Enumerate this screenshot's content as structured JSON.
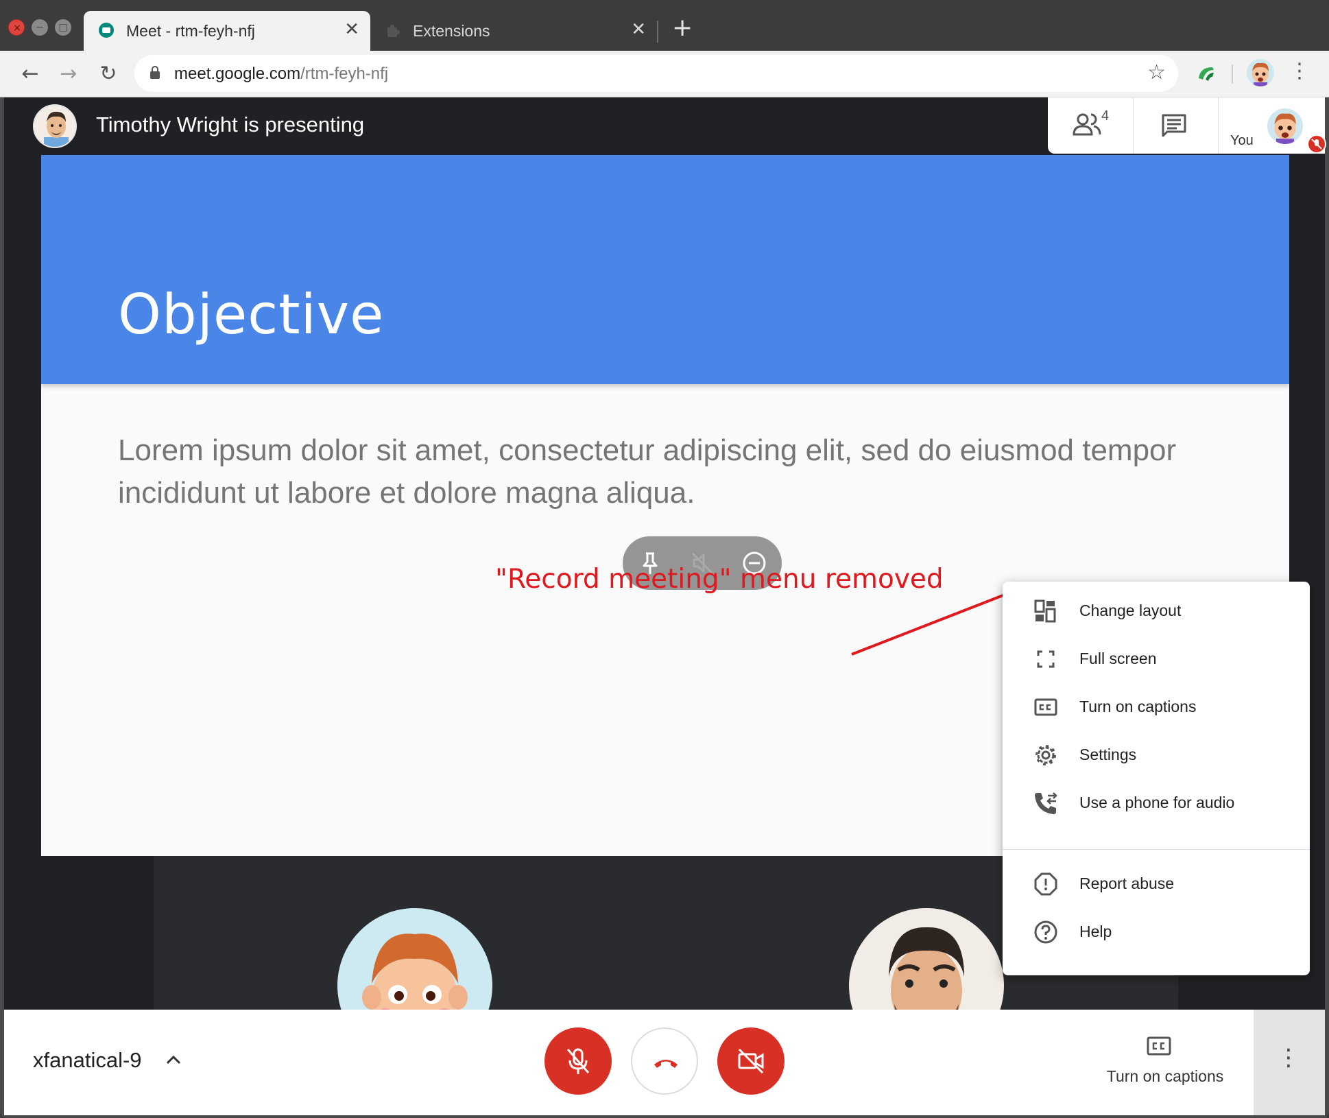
{
  "browser": {
    "tabs": [
      {
        "title": "Meet - rtm-feyh-nfj",
        "close": "✕"
      },
      {
        "title": "Extensions",
        "close": "✕"
      }
    ],
    "new_tab_glyph": "+",
    "url_host": "meet.google.com",
    "url_path": "/rtm-feyh-nfj",
    "nav": {
      "back": "←",
      "forward": "→",
      "reload": "↻"
    },
    "star": "☆",
    "menu_glyph": "⋮",
    "window_buttons": {
      "close": "×",
      "minimize": "−",
      "zoom": "□"
    }
  },
  "meet": {
    "presenting_text": "Timothy Wright is presenting",
    "participants_count": "4",
    "you_label": "You",
    "slide": {
      "title": "Objective",
      "body": "Lorem ipsum dolor sit amet, consectetur adipiscing elit, sed do eiusmod tempor incididunt ut labore et dolore magna aliqua."
    },
    "annotation": "\"Record meeting\" menu removed",
    "menu": {
      "items": [
        {
          "label": "Change layout",
          "icon": "change-layout-icon"
        },
        {
          "label": "Full screen",
          "icon": "fullscreen-icon"
        },
        {
          "label": "Turn on captions",
          "icon": "captions-icon"
        },
        {
          "label": "Settings",
          "icon": "gear-icon"
        },
        {
          "label": "Use a phone for audio",
          "icon": "phone-audio-icon"
        },
        {
          "label": "Report abuse",
          "icon": "report-icon"
        },
        {
          "label": "Help",
          "icon": "help-icon"
        }
      ]
    },
    "bottom": {
      "meeting_code": "xfanatical-9",
      "captions_label": "Turn on captions",
      "more_glyph": "⋮"
    },
    "colors": {
      "slide_header": "#4a86e8",
      "danger": "#d93025",
      "annotation": "#e0191e"
    }
  }
}
